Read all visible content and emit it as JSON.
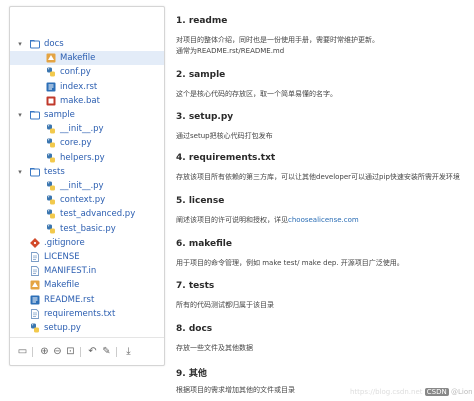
{
  "tree": [
    {
      "name": "docs",
      "type": "folder",
      "depth": 0,
      "expanded": true
    },
    {
      "name": "Makefile",
      "type": "make",
      "depth": 1,
      "selected": true
    },
    {
      "name": "conf.py",
      "type": "py",
      "depth": 1
    },
    {
      "name": "index.rst",
      "type": "rst",
      "depth": 1
    },
    {
      "name": "make.bat",
      "type": "bat",
      "depth": 1
    },
    {
      "name": "sample",
      "type": "folder",
      "depth": 0,
      "expanded": true
    },
    {
      "name": "__init__.py",
      "type": "py",
      "depth": 1
    },
    {
      "name": "core.py",
      "type": "py",
      "depth": 1
    },
    {
      "name": "helpers.py",
      "type": "py",
      "depth": 1
    },
    {
      "name": "tests",
      "type": "folder",
      "depth": 0,
      "expanded": true
    },
    {
      "name": "__init__.py",
      "type": "py",
      "depth": 1
    },
    {
      "name": "context.py",
      "type": "py",
      "depth": 1
    },
    {
      "name": "test_advanced.py",
      "type": "py",
      "depth": 1
    },
    {
      "name": "test_basic.py",
      "type": "py",
      "depth": 1
    },
    {
      "name": ".gitignore",
      "type": "git",
      "depth": 0
    },
    {
      "name": "LICENSE",
      "type": "txt",
      "depth": 0
    },
    {
      "name": "MANIFEST.in",
      "type": "txt",
      "depth": 0
    },
    {
      "name": "Makefile",
      "type": "make",
      "depth": 0
    },
    {
      "name": "README.rst",
      "type": "rst",
      "depth": 0
    },
    {
      "name": "requirements.txt",
      "type": "txt",
      "depth": 0
    },
    {
      "name": "setup.py",
      "type": "py",
      "depth": 0
    }
  ],
  "toolbar": {
    "icons": [
      "save-icon",
      "zoom-in-icon",
      "zoom-out-icon",
      "fit-icon",
      "undo-icon",
      "edit-icon",
      "download-icon"
    ]
  },
  "doc": {
    "sections": [
      {
        "heading": "1. readme",
        "lines": [
          "对项目的整体介绍，同时也是一份使用手册，需要时常维护更新。",
          "通常为README.rst/README.md"
        ]
      },
      {
        "heading": "2. sample",
        "lines": [
          "这个是核心代码的存放区，取一个简单易懂的名字。"
        ]
      },
      {
        "heading": "3. setup.py",
        "lines": [
          "通过setup把核心代码打包发布"
        ]
      },
      {
        "heading": "4. requirements.txt",
        "lines": [
          "存放该项目所有依赖的第三方库，可以让其他developer可以通过pip快速安装所需开发环境"
        ]
      },
      {
        "heading": "5. license",
        "lines": [
          "阐述该项目的许可说明和授权，详见"
        ],
        "link": "choosealicense.com"
      },
      {
        "heading": "6. makefile",
        "lines": [
          "用于项目的命令管理，例如 make test/ make dep. 开源项目广泛使用。"
        ]
      },
      {
        "heading": "7. tests",
        "lines": [
          "所有的代码测试都归属于该目录"
        ]
      },
      {
        "heading": "8. docs",
        "lines": [
          "存放一些文件及其他数据"
        ]
      },
      {
        "heading": "9. 其他",
        "lines": [
          "根据项目的需求增加其他的文件或目录"
        ]
      }
    ]
  },
  "watermark": {
    "prefix": "CSDN",
    "text": "@Lion King",
    "faint": "https://blog.csdn.net"
  },
  "colors": {
    "link": "#2a6db5",
    "selected": "#e3ecf8",
    "folder": "#3a78c4",
    "python": "#3b76b0",
    "make": "#e4a443",
    "bat": "#c0392b",
    "git": "#d24a2a"
  }
}
